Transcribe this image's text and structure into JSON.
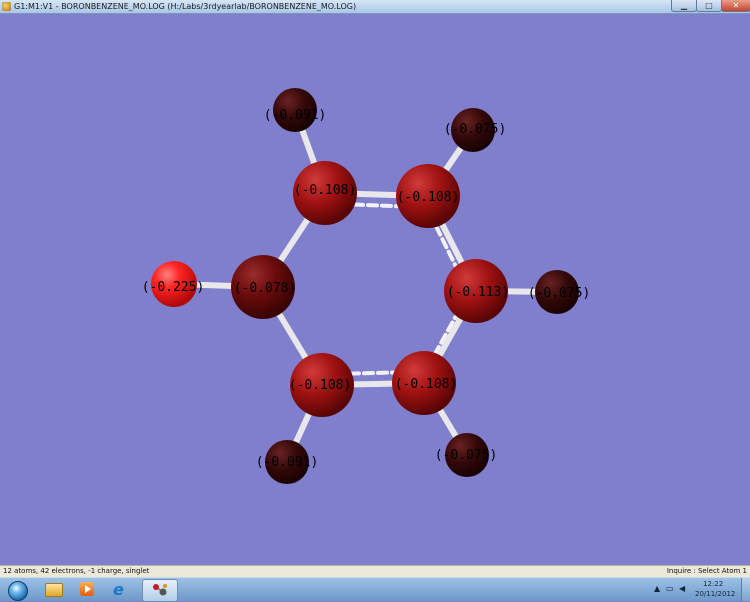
{
  "window": {
    "title": "G1:M1:V1 - BORONBENZENE_MO.LOG (H:/Labs/3rdyearlab/BORONBENZENE_MO.LOG)",
    "minimize_icon": "minimize-icon",
    "maximize_icon": "maximize-icon",
    "close_icon": "close-icon"
  },
  "molecule": {
    "background": "#7f7fce",
    "bond_color": "#e8e8ec",
    "atoms": [
      {
        "label": "(-0.091)",
        "element": "H",
        "color": "#3a0a0a"
      },
      {
        "label": "(-0.075)",
        "element": "H",
        "color": "#3a0a0a"
      },
      {
        "label": "(-0.108)",
        "element": "C",
        "color": "#9e1010"
      },
      {
        "label": "(-0.108)",
        "element": "C",
        "color": "#9e1010"
      },
      {
        "label": "(-0.225)",
        "element": "Cl",
        "color": "#ff2020"
      },
      {
        "label": "(-0.078)",
        "element": "B",
        "color": "#6a0b0b"
      },
      {
        "label": "(-0.113)",
        "element": "C",
        "color": "#9e1010"
      },
      {
        "label": "(-0.075)",
        "element": "H",
        "color": "#3a0a0a"
      },
      {
        "label": "(-0.108)",
        "element": "C",
        "color": "#9e1010"
      },
      {
        "label": "(-0.108)",
        "element": "C",
        "color": "#9e1010"
      },
      {
        "label": "(-0.091)",
        "element": "H",
        "color": "#3a0a0a"
      },
      {
        "label": "(-0.075)",
        "element": "H",
        "color": "#3a0a0a"
      }
    ]
  },
  "status": {
    "left": "12 atoms, 42 electrons, -1 charge, singlet",
    "right": "Inquire : Select Atom 1"
  },
  "taskbar": {
    "start_icon": "windows-start-icon",
    "apps": [
      {
        "name": "explorer",
        "icon": "folder-icon"
      },
      {
        "name": "media-player",
        "icon": "media-player-icon"
      },
      {
        "name": "internet-explorer",
        "icon": "internet-explorer-icon",
        "glyph": "e"
      },
      {
        "name": "gaussview",
        "icon": "gaussview-icon"
      }
    ],
    "tray": {
      "time": "12:22",
      "date": "20/11/2012"
    }
  }
}
